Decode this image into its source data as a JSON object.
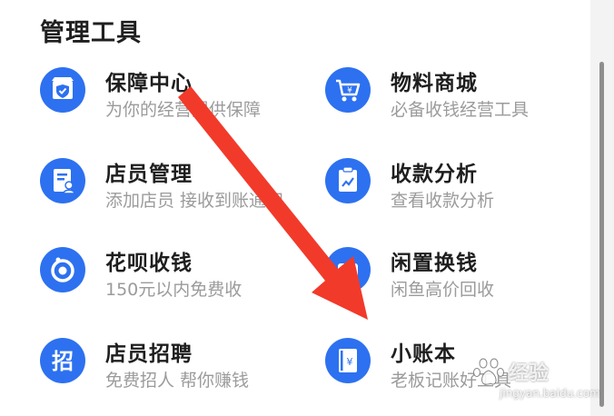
{
  "section": {
    "title": "管理工具"
  },
  "tools": [
    {
      "title": "保障中心",
      "subtitle": "为你的经营提供保障",
      "icon": "shield-store-icon"
    },
    {
      "title": "物料商城",
      "subtitle": "必备收钱经营工具",
      "icon": "shopping-cart-yen-icon"
    },
    {
      "title": "店员管理",
      "subtitle": "添加店员 接收到账通知",
      "icon": "staff-document-icon"
    },
    {
      "title": "收款分析",
      "subtitle": "查看收款分析",
      "icon": "clipboard-chart-icon"
    },
    {
      "title": "花呗收钱",
      "subtitle": "150元以内免费收",
      "icon": "huabei-icon"
    },
    {
      "title": "闲置换钱",
      "subtitle": "闲鱼高价回收",
      "icon": "idle-fish-icon"
    },
    {
      "title": "店员招聘",
      "subtitle": "免费招人 帮你赚钱",
      "icon": "recruit-icon",
      "glyph": "招"
    },
    {
      "title": "小账本",
      "subtitle": "老板记账好工具",
      "icon": "ledger-book-icon"
    }
  ],
  "watermark": {
    "text": "经验",
    "url": "jingyan.baidu.com"
  },
  "colors": {
    "icon_blue": "#2d71f0",
    "arrow_red": "#f23a2a",
    "subtitle_gray": "#9b9b9b"
  }
}
